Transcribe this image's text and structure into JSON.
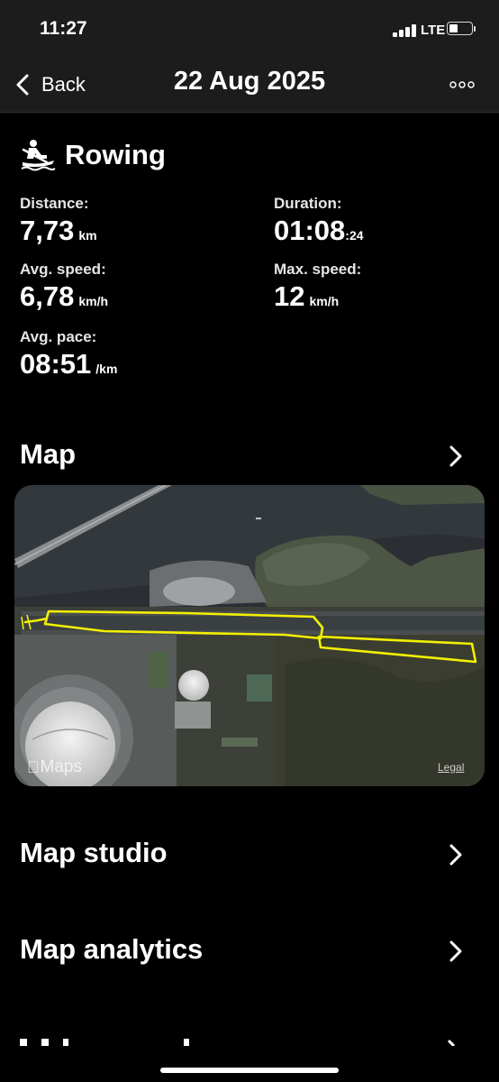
{
  "status_bar": {
    "time": "11:27",
    "network": "LTE"
  },
  "nav": {
    "back_label": "Back",
    "title": "22 Aug 2025",
    "more_icon": "ellipsis-icon"
  },
  "activity": {
    "icon": "rowing-icon",
    "title": "Rowing",
    "stats": {
      "distance": {
        "label": "Distance:",
        "value": "7,73",
        "unit": "km"
      },
      "duration": {
        "label": "Duration:",
        "value": "01:08",
        "seconds": ":24"
      },
      "avg_speed": {
        "label": "Avg. speed:",
        "value": "6,78",
        "unit": "km/h"
      },
      "max_speed": {
        "label": "Max. speed:",
        "value": "12",
        "unit": "km/h"
      },
      "avg_pace": {
        "label": "Avg. pace:",
        "value": "08:51",
        "unit": "/km"
      }
    }
  },
  "sections": {
    "map": {
      "title": "Map",
      "maps_logo": "Maps",
      "legal": "Legal",
      "route_color": "#f2f000"
    },
    "map_studio": {
      "title": "Map studio"
    },
    "map_analytics": {
      "title": "Map analytics"
    }
  },
  "colors": {
    "background": "#000000",
    "bar": "#1c1c1c",
    "text": "#ffffff"
  }
}
